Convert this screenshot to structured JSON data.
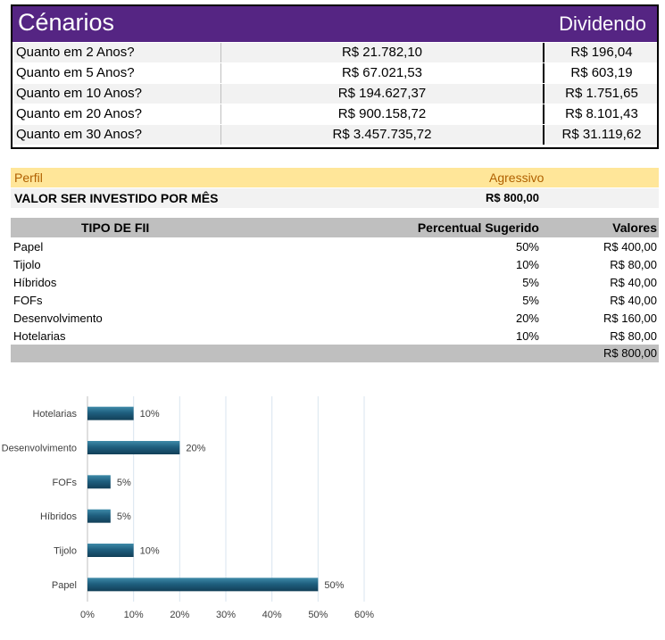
{
  "cenarios": {
    "title": "Cénarios",
    "dividendo_header": "Dividendo",
    "rows": [
      {
        "label": "Quanto em 2 Anos?",
        "valor": "R$ 21.782,10",
        "dividendo": "R$ 196,04"
      },
      {
        "label": "Quanto em 5 Anos?",
        "valor": "R$ 67.021,53",
        "dividendo": "R$ 603,19"
      },
      {
        "label": "Quanto em 10 Anos?",
        "valor": "R$ 194.627,37",
        "dividendo": "R$ 1.751,65"
      },
      {
        "label": "Quanto em 20 Anos?",
        "valor": "R$ 900.158,72",
        "dividendo": "R$ 8.101,43"
      },
      {
        "label": "Quanto em 30 Anos?",
        "valor": "R$ 3.457.735,72",
        "dividendo": "R$ 31.119,62"
      }
    ]
  },
  "perfil": {
    "label": "Perfil",
    "value": "Agressivo",
    "valor_label": "VALOR SER INVESTIDO POR MÊS",
    "valor_value": "R$ 800,00"
  },
  "fii": {
    "headers": [
      "TIPO DE FII",
      "Percentual Sugerido",
      "Valores"
    ],
    "rows": [
      {
        "tipo": "Papel",
        "percentual": "50%",
        "valor": "R$ 400,00"
      },
      {
        "tipo": "Tijolo",
        "percentual": "10%",
        "valor": "R$ 80,00"
      },
      {
        "tipo": "Híbridos",
        "percentual": "5%",
        "valor": "R$ 40,00"
      },
      {
        "tipo": "FOFs",
        "percentual": "5%",
        "valor": "R$ 40,00"
      },
      {
        "tipo": "Desenvolvimento",
        "percentual": "20%",
        "valor": "R$ 160,00"
      },
      {
        "tipo": "Hotelarias",
        "percentual": "10%",
        "valor": "R$ 80,00"
      }
    ],
    "total": "R$ 800,00"
  },
  "colors": {
    "header_purple": "#552583",
    "perfil_yellow": "#ffe699",
    "bar_blue": "#1f5f7f"
  },
  "chart_data": {
    "type": "bar",
    "orientation": "horizontal",
    "categories": [
      "Hotelarias",
      "Desenvolvimento",
      "FOFs",
      "Híbridos",
      "Tijolo",
      "Papel"
    ],
    "values": [
      10,
      20,
      5,
      5,
      10,
      50
    ],
    "data_labels": [
      "10%",
      "20%",
      "5%",
      "5%",
      "10%",
      "50%"
    ],
    "xlim": [
      0,
      60
    ],
    "xticks": [
      "0%",
      "10%",
      "20%",
      "30%",
      "40%",
      "50%",
      "60%"
    ],
    "grid": true,
    "title": "",
    "xlabel": "",
    "ylabel": ""
  }
}
